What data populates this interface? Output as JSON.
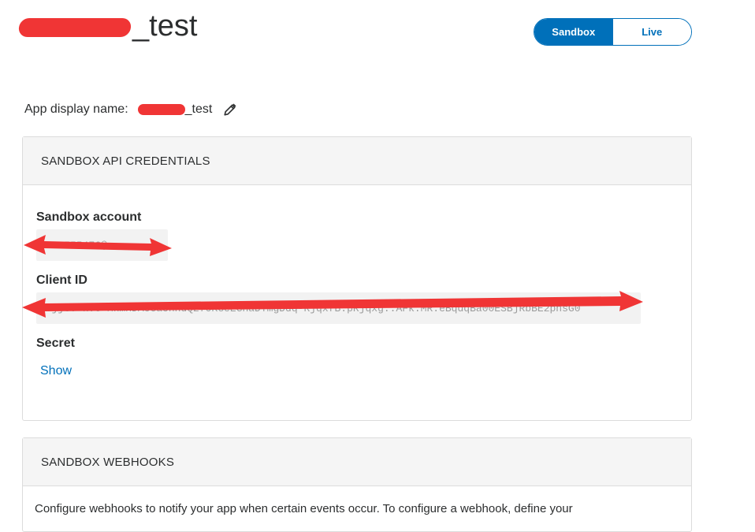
{
  "header": {
    "app_title": "_test",
    "environment_toggle": {
      "options": [
        "Sandbox",
        "Live"
      ],
      "selected": "Sandbox"
    }
  },
  "app_display": {
    "label": "App display name:",
    "value_suffix": "_test"
  },
  "credentials": {
    "heading": "SANDBOX API CREDENTIALS",
    "sandbox_account_label": "Sandbox account",
    "sandbox_account_value": "4052555476@...",
    "client_id_label": "Client ID",
    "client_id_value": "ATjjU.-k.0-MkmxDAcGaUhhdQ27OKGeEGhaDTmgDdq-RjqxfB.pRjqxg..AFk.MR.eBqdqBa00ESBjRbBE2phsG0",
    "secret_label": "Secret",
    "show_link": "Show"
  },
  "webhooks": {
    "heading": "SANDBOX WEBHOOKS",
    "description": "Configure webhooks to notify your app when certain events occur. To configure a webhook, define your"
  },
  "colors": {
    "accent": "#0070ba",
    "redaction": "#f03535",
    "panel_header": "#f5f5f5"
  }
}
